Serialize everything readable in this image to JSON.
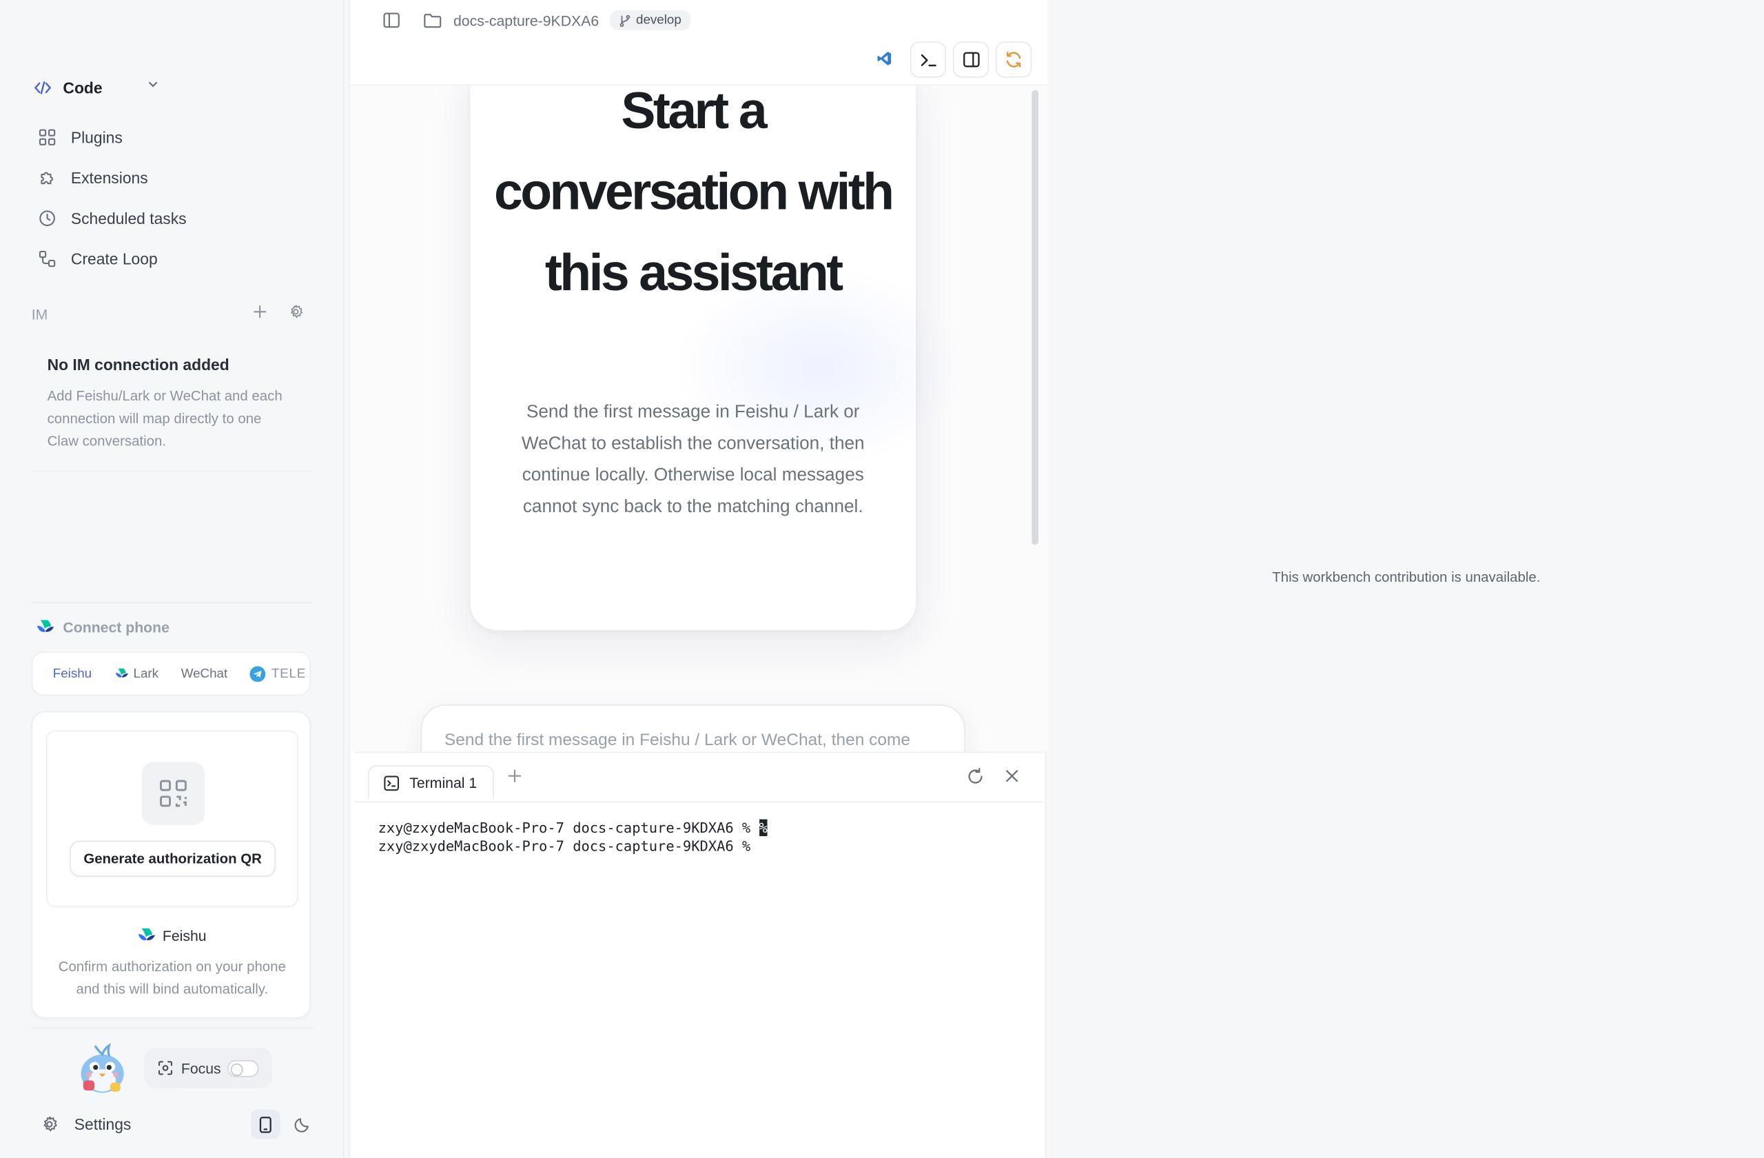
{
  "sidebar": {
    "mode_label": "Code",
    "nav": [
      {
        "label": "Plugins",
        "icon": "grid-icon"
      },
      {
        "label": "Extensions",
        "icon": "puzzle-icon"
      },
      {
        "label": "Scheduled tasks",
        "icon": "clock-icon"
      },
      {
        "label": "Create Loop",
        "icon": "loop-icon"
      }
    ],
    "im": {
      "label": "IM",
      "empty_title": "No IM connection added",
      "empty_desc": "Add Feishu/Lark or WeChat and each connection will map directly to one Claw conversation."
    },
    "connect_phone": {
      "label": "Connect phone",
      "tabs": [
        "Feishu",
        "Lark",
        "WeChat",
        "TELE"
      ],
      "active_tab": "Feishu",
      "generate_button": "Generate authorization QR",
      "provider": "Feishu",
      "desc": "Confirm authorization on your phone and this will bind automatically."
    },
    "focus_label": "Focus",
    "settings_label": "Settings"
  },
  "topbar": {
    "workspace": "docs-capture-9KDXA6",
    "branch": "develop"
  },
  "chat": {
    "hero_title": "Start a conversation with this assistant",
    "hero_desc": "Send the first message in Feishu / Lark or WeChat to establish the conversation, then continue locally. Otherwise local messages cannot sync back to the matching channel.",
    "input_placeholder": "Send the first message in Feishu / Lark or WeChat, then come"
  },
  "terminal": {
    "tab_label": "Terminal 1",
    "line1_prompt": "zxy@zxydeMacBook-Pro-7 docs-capture-9KDXA6 % ",
    "line1_cursor": "%",
    "line2_prompt": "zxy@zxydeMacBook-Pro-7 docs-capture-9KDXA6 %"
  },
  "right_panel": {
    "message": "This workbench contribution is unavailable."
  },
  "colors": {
    "accent": "#4f67c9",
    "refresh_accent": "#e8963a",
    "vscode_blue": "#2f7fd8"
  }
}
